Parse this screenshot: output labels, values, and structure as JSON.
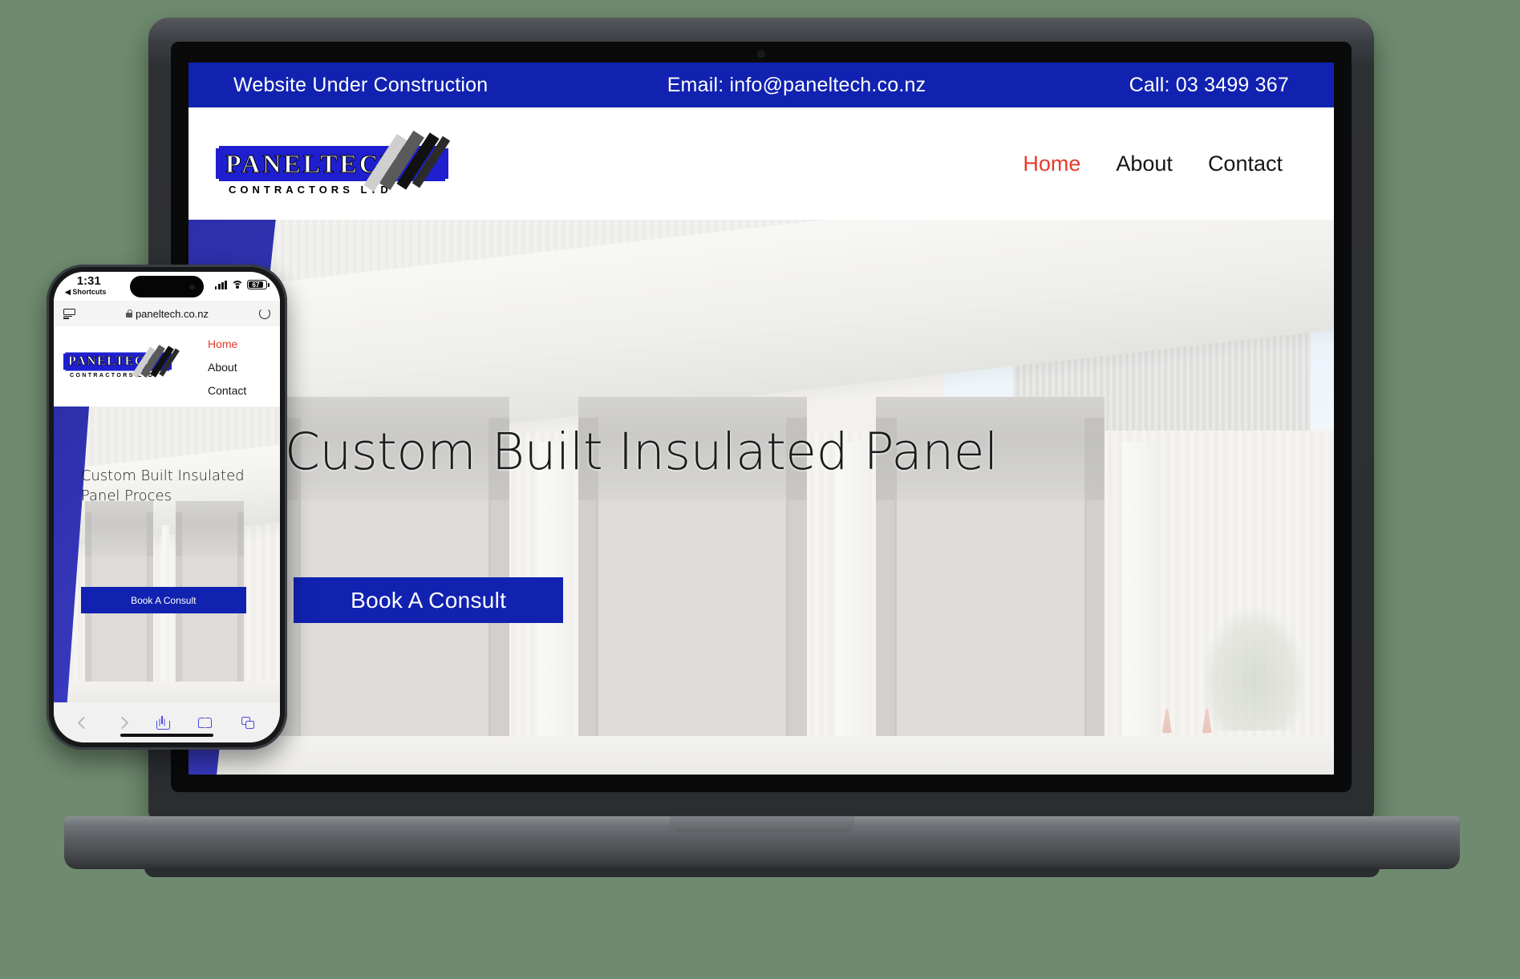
{
  "site": {
    "announcement_bar": {
      "left": "Website Under Construction",
      "middle": "Email: info@paneltech.co.nz",
      "right": "Call: 03 3499 367"
    },
    "logo": {
      "word": "PANELTECH",
      "subtitle": "CONTRACTORS LTD"
    },
    "nav": [
      {
        "label": "Home",
        "active": true
      },
      {
        "label": "About",
        "active": false
      },
      {
        "label": "Contact",
        "active": false
      }
    ],
    "hero": {
      "title": "Custom Built Insulated Panel",
      "cta": "Book A Consult"
    },
    "colors": {
      "brand_blue": "#1122b0",
      "logo_blue": "#1f1fd0",
      "active_link_red": "#e83a2c"
    }
  },
  "phone": {
    "status": {
      "time": "1:31",
      "shortcuts_label": "Shortcuts",
      "battery_percent": "67"
    },
    "browser": {
      "url": "paneltech.co.nz"
    },
    "nav": [
      {
        "label": "Home",
        "active": true
      },
      {
        "label": "About",
        "active": false
      },
      {
        "label": "Contact",
        "active": false
      }
    ],
    "hero": {
      "title": "Custom Built Insulated Panel Proces",
      "cta": "Book A Consult"
    },
    "logo": {
      "word": "PANELTECH",
      "subtitle": "CONTRACTORS LTD"
    }
  }
}
